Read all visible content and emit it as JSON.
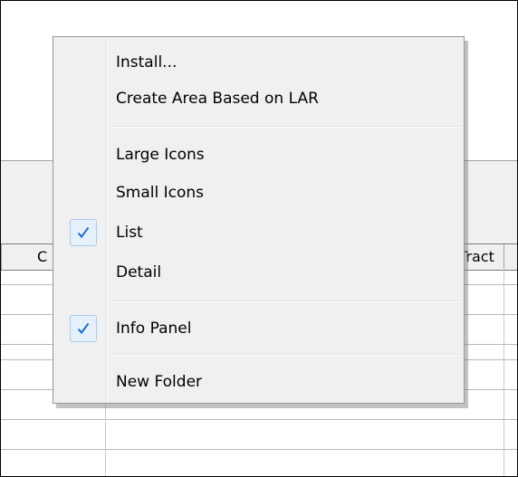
{
  "table": {
    "headers": [
      {
        "label": "C"
      },
      {
        "label": "Tract"
      }
    ]
  },
  "context_menu": {
    "items": [
      {
        "label": "Install...",
        "checked": false
      },
      {
        "label": "Create Area Based on LAR",
        "checked": false
      },
      {
        "label": "Large Icons",
        "checked": false
      },
      {
        "label": "Small Icons",
        "checked": false
      },
      {
        "label": "List",
        "checked": true
      },
      {
        "label": "Detail",
        "checked": false
      },
      {
        "label": "Info Panel",
        "checked": true
      },
      {
        "label": "New Folder",
        "checked": false
      }
    ],
    "check_icon": "checkmark-icon",
    "check_color": "#1a6fd1"
  }
}
